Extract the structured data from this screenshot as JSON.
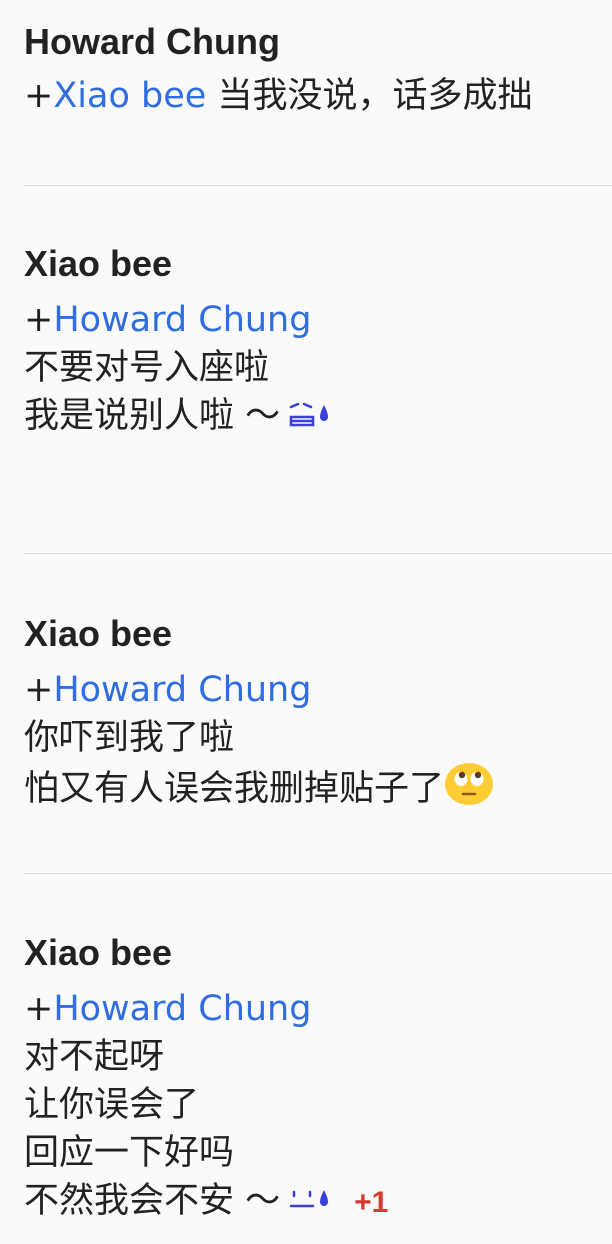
{
  "comments": [
    {
      "author": "Howard Chung",
      "plus": "+",
      "mention": "Xiao bee",
      "inline_text": " 当我没说，话多成拙",
      "lines": []
    },
    {
      "author": "Xiao bee",
      "plus": "+",
      "mention": "Howard Chung",
      "lines": [
        "不要对号入座啦",
        "我是说别人啦 ～"
      ],
      "trailing_icon": "sweat-smile-kaomoji-icon"
    },
    {
      "author": "Xiao bee",
      "plus": "+",
      "mention": "Howard Chung",
      "lines": [
        "你吓到我了啦",
        "怕又有人误会我删掉贴子了"
      ],
      "trailing_icon": "eye-roll-emoji-icon"
    },
    {
      "author": "Xiao bee",
      "plus": "+",
      "mention": "Howard Chung",
      "lines": [
        "对不起呀",
        "让你误会了",
        "回应一下好吗",
        "不然我会不安 ～"
      ],
      "trailing_icon": "sweat-kaomoji-icon",
      "plus_one": "+1"
    }
  ],
  "colors": {
    "background": "#fafafa",
    "text": "#222222",
    "mention": "#2f6de1",
    "plus_one": "#d43a2f",
    "divider": "#dddddd"
  }
}
